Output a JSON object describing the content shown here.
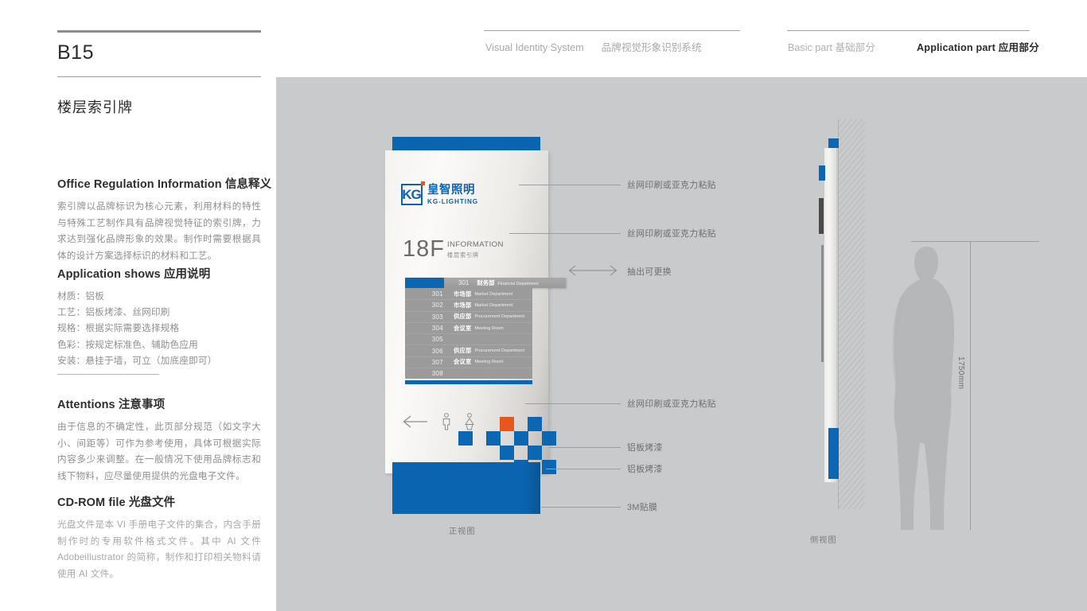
{
  "page": {
    "code": "B15",
    "section_title": "楼层索引牌"
  },
  "header": {
    "vis_en": "Visual Identity System",
    "vis_cn": "品牌视觉形象识别系统",
    "basic_part": "Basic part  基础部分",
    "application_part": "Application part  应用部分"
  },
  "sidebar": {
    "blocks": [
      {
        "title_en": "Office Regulation Information",
        "title_cn": "信息释义",
        "body": "索引牌以品牌标识为核心元素，利用材料的特性与特殊工艺制作具有品牌视觉特征的索引牌，力求达到强化品牌形象的效果。制作时需要根据具体的设计方案选择标识的材料和工艺。"
      },
      {
        "title_en": "Application shows",
        "title_cn": "应用说明",
        "specs": [
          "材质：铝板",
          "工艺：铝板烤漆、丝网印刷",
          "规格：根据实际需要选择规格",
          "色彩：按规定标准色、辅助色应用",
          "安装：悬挂于墙，可立（加底座即可）"
        ]
      },
      {
        "title_en": "Attentions",
        "title_cn": "注意事项",
        "body": "由于信息的不确定性，此页部分规范（如文字大小、间距等）可作为参考使用，具体可根据实际内容多少来调整。在一般情况下使用品牌标志和线下物料，应尽量使用提供的光盘电子文件。"
      },
      {
        "title_en": "CD-ROM file",
        "title_cn": "光盘文件",
        "body": "光盘文件是本 VI 手册电子文件的集合，内含手册制作时的专用软件格式文件。其中 AI 文件 Adobeillustrator 的简称，制作和打印相关物料请使用 AI 文件。"
      }
    ]
  },
  "sign": {
    "logo": {
      "mark_text": "KG",
      "brand_cn": "皇智照明",
      "brand_en": "KG-LIGHTING",
      "dot_color": "#e8561f",
      "brand_color": "#0f62b2"
    },
    "floor": {
      "number": "18F",
      "info_en": "INFORMATION",
      "info_cn": "楼层索引牌"
    },
    "pullout_slat": {
      "number": "301",
      "cn": "财务部",
      "en": "Financial Department"
    },
    "directory": [
      {
        "number": "301",
        "cn": "市场部",
        "en": "Market Department"
      },
      {
        "number": "302",
        "cn": "市场部",
        "en": "Market Department"
      },
      {
        "number": "303",
        "cn": "供应部",
        "en": "Procurement Department"
      },
      {
        "number": "304",
        "cn": "会议室",
        "en": "Meeting Room"
      },
      {
        "number": "305",
        "cn": "",
        "en": ""
      },
      {
        "number": "306",
        "cn": "供应部",
        "en": "Procurement Department"
      },
      {
        "number": "307",
        "cn": "会议室",
        "en": "Meeting Room"
      },
      {
        "number": "308",
        "cn": "",
        "en": ""
      }
    ],
    "colors": {
      "blue": "#0d66b2",
      "orange": "#e8561f",
      "panel_gray": "#9b9b9b"
    }
  },
  "annotations": [
    {
      "id": "anno-1",
      "text": "丝网印刷或亚克力粘贴"
    },
    {
      "id": "anno-2",
      "text": "丝网印刷或亚克力粘贴"
    },
    {
      "id": "anno-3",
      "text": "抽出可更换"
    },
    {
      "id": "anno-4",
      "text": "丝网印刷或亚克力粘贴"
    },
    {
      "id": "anno-5",
      "text": "铝板烤漆"
    },
    {
      "id": "anno-6",
      "text": "铝板烤漆"
    },
    {
      "id": "anno-7",
      "text": "3M贴膜"
    }
  ],
  "views": {
    "front_label": "正视图",
    "side_label": "侧视图"
  },
  "dimension": {
    "height_label": "1750mm"
  }
}
